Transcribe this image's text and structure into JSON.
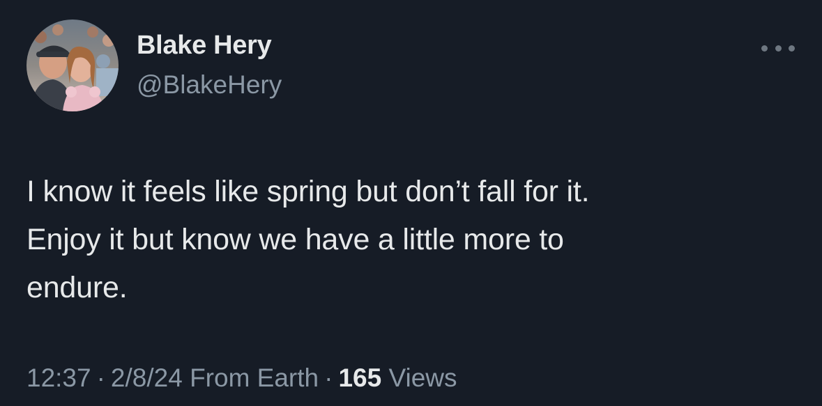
{
  "user": {
    "display_name": "Blake Hery",
    "handle": "@BlakeHery",
    "avatar": "profile-photo"
  },
  "more_icon": "ellipsis-icon",
  "tweet": {
    "text": "I know it feels like spring but don’t fall for it.\nEnjoy it but know we have a little more to\nendure."
  },
  "meta": {
    "time": "12:37",
    "separator": "·",
    "date": "2/8/24",
    "source": "From Earth",
    "views_count": "165",
    "views_label": "Views"
  },
  "colors": {
    "background": "#161c26",
    "primary_text": "#e7e9ea",
    "secondary_text": "#8b98a5"
  }
}
